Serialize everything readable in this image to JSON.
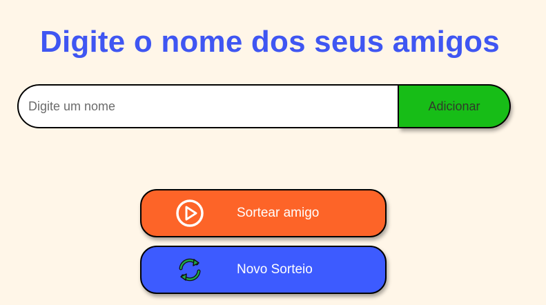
{
  "header": {
    "title": "Digite o nome dos seus amigos"
  },
  "form": {
    "placeholder": "Digite um nome",
    "value": "",
    "add_label": "Adicionar"
  },
  "actions": {
    "draw_label": "Sortear amigo",
    "draw_icon": "play-circle-icon",
    "reset_label": "Novo Sorteio",
    "reset_icon": "refresh-icon"
  },
  "colors": {
    "background": "#FFF6E8",
    "title": "#3F56F2",
    "add_button": "#17BD17",
    "draw_button": "#FD6428",
    "reset_button": "#3D5BFF",
    "reset_icon": "#1FA64A"
  }
}
